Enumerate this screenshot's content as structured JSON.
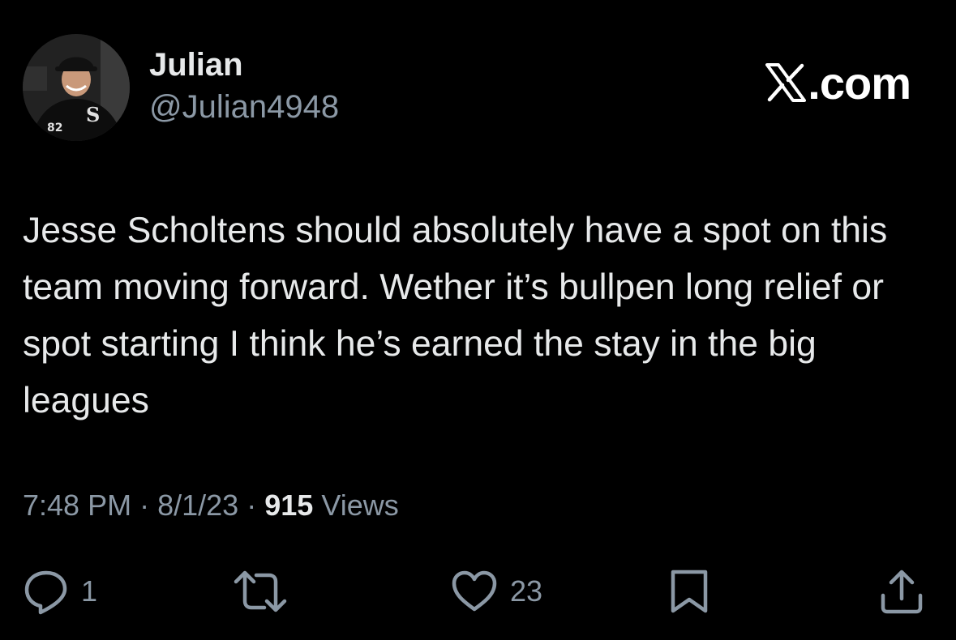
{
  "author": {
    "display_name": "Julian",
    "handle": "@Julian4948",
    "avatar_jersey_number": "82"
  },
  "brand": {
    "suffix": ".com"
  },
  "tweet": {
    "text": "Jesse Scholtens should absolutely have a spot on this team moving forward. Wether it’s bullpen long relief or spot starting I think he’s earned the stay in the big leagues",
    "time": "7:48 PM",
    "separator": "·",
    "date": "8/1/23",
    "views_count": "915",
    "views_label": "Views"
  },
  "actions": {
    "reply": {
      "icon": "reply-icon",
      "count": "1"
    },
    "retweet": {
      "icon": "retweet-icon",
      "count": ""
    },
    "like": {
      "icon": "heart-icon",
      "count": "23"
    },
    "bookmark": {
      "icon": "bookmark-icon"
    },
    "share": {
      "icon": "share-icon"
    }
  },
  "colors": {
    "background": "#000000",
    "primary_text": "#e7e9ea",
    "secondary_text": "#8b98a5"
  }
}
